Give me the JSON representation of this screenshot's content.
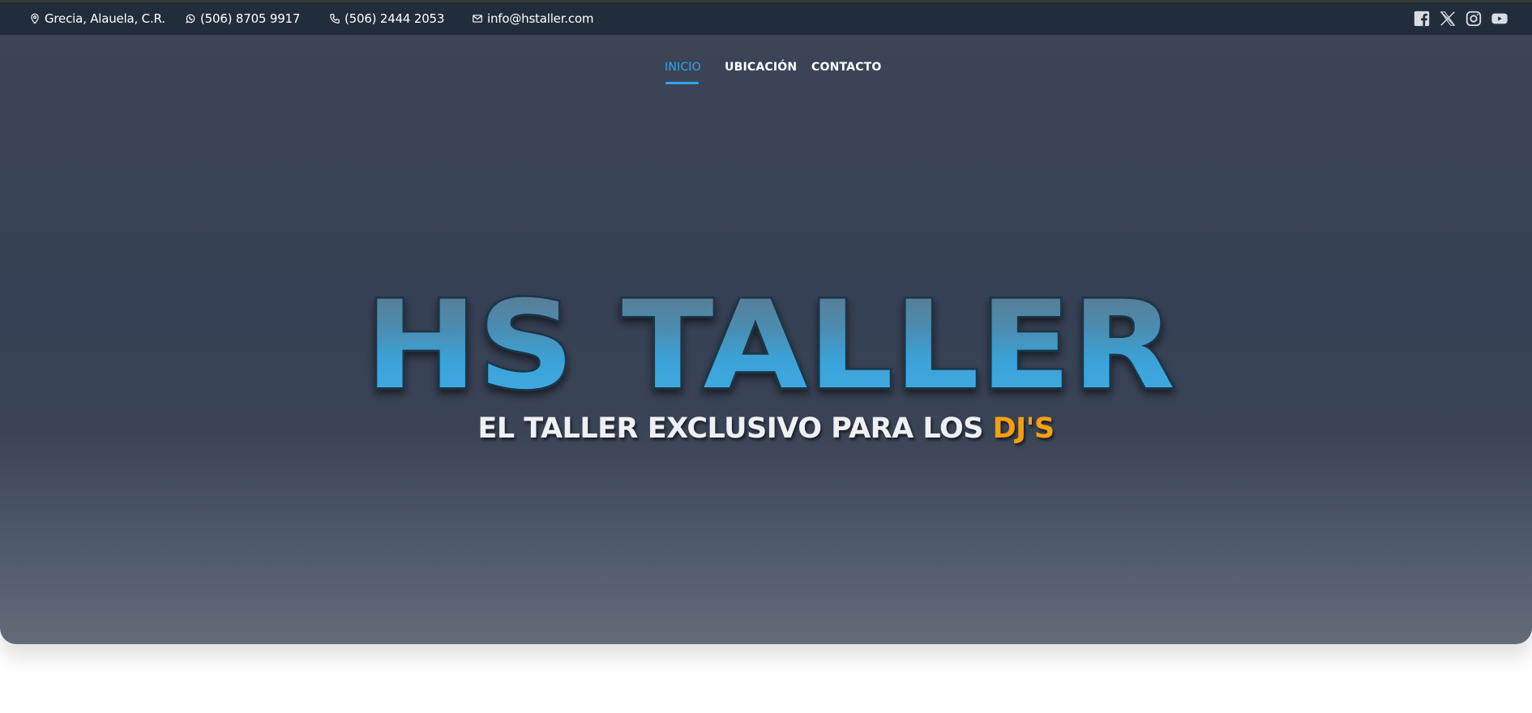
{
  "topbar": {
    "location": "Grecia, Alauela, C.R.",
    "whatsapp": "(506) 8705 9917",
    "phone": "(506) 2444 2053",
    "email": "info@hstaller.com",
    "social_icons": [
      "facebook-icon",
      "x-icon",
      "instagram-icon",
      "youtube-icon"
    ]
  },
  "nav": {
    "items": [
      {
        "label": "INICIO",
        "active": true
      },
      {
        "label": "UBICACIÓN",
        "active": false
      },
      {
        "label": "CONTACTO",
        "active": false
      }
    ]
  },
  "hero": {
    "logo_text": "HS TALLER",
    "tagline_main": "EL TALLER EXCLUSIVO PARA LOS ",
    "tagline_accent": "DJ'S"
  },
  "colors": {
    "topbar_bg": "#222d3b",
    "hero_bg": "#364054",
    "accent_blue": "#2fa7ec",
    "accent_orange": "#f5a00f"
  }
}
